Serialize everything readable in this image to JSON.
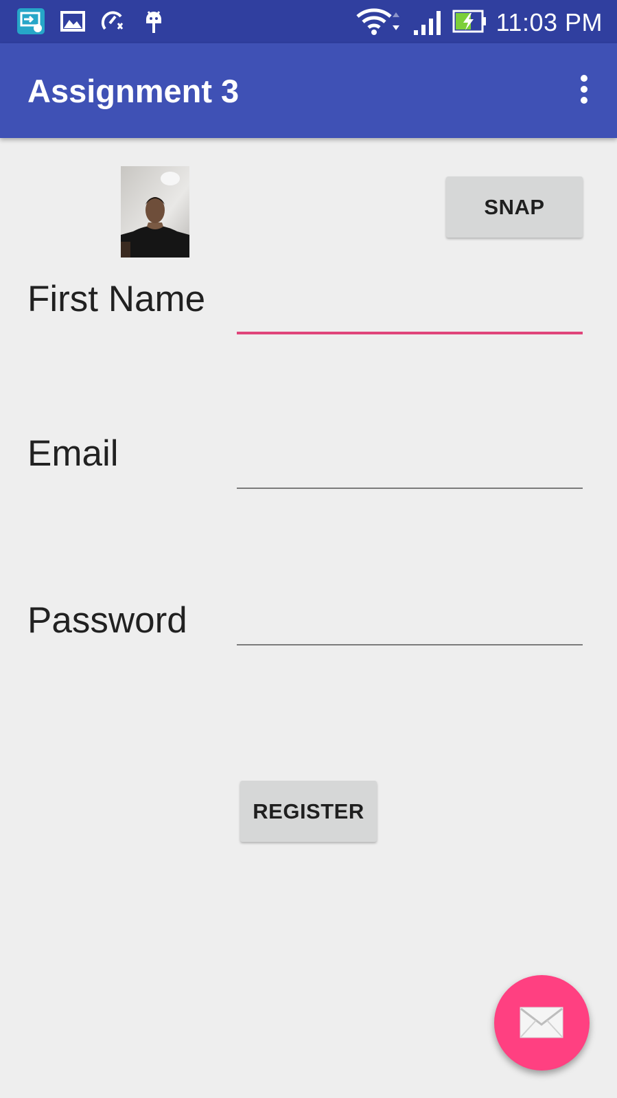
{
  "status_bar": {
    "time": "11:03 PM",
    "icons": [
      "screen-mirror-icon",
      "gallery-icon",
      "speed-booster-icon",
      "android-debug-icon",
      "wifi-icon",
      "cell-signal-icon",
      "battery-charging-icon"
    ],
    "background_color": "#303f9f"
  },
  "app_bar": {
    "title": "Assignment 3",
    "menu_icon": "overflow-menu-icon",
    "background_color": "#3f51b5"
  },
  "form": {
    "snap_label": "SNAP",
    "photo": "profile-photo",
    "fields": [
      {
        "label": "First Name",
        "value": "",
        "focused": true
      },
      {
        "label": "Email",
        "value": "",
        "focused": false
      },
      {
        "label": "Password",
        "value": "",
        "focused": false
      }
    ],
    "register_label": "REGISTER"
  },
  "fab": {
    "icon": "mail-icon",
    "color": "#ff4081"
  }
}
